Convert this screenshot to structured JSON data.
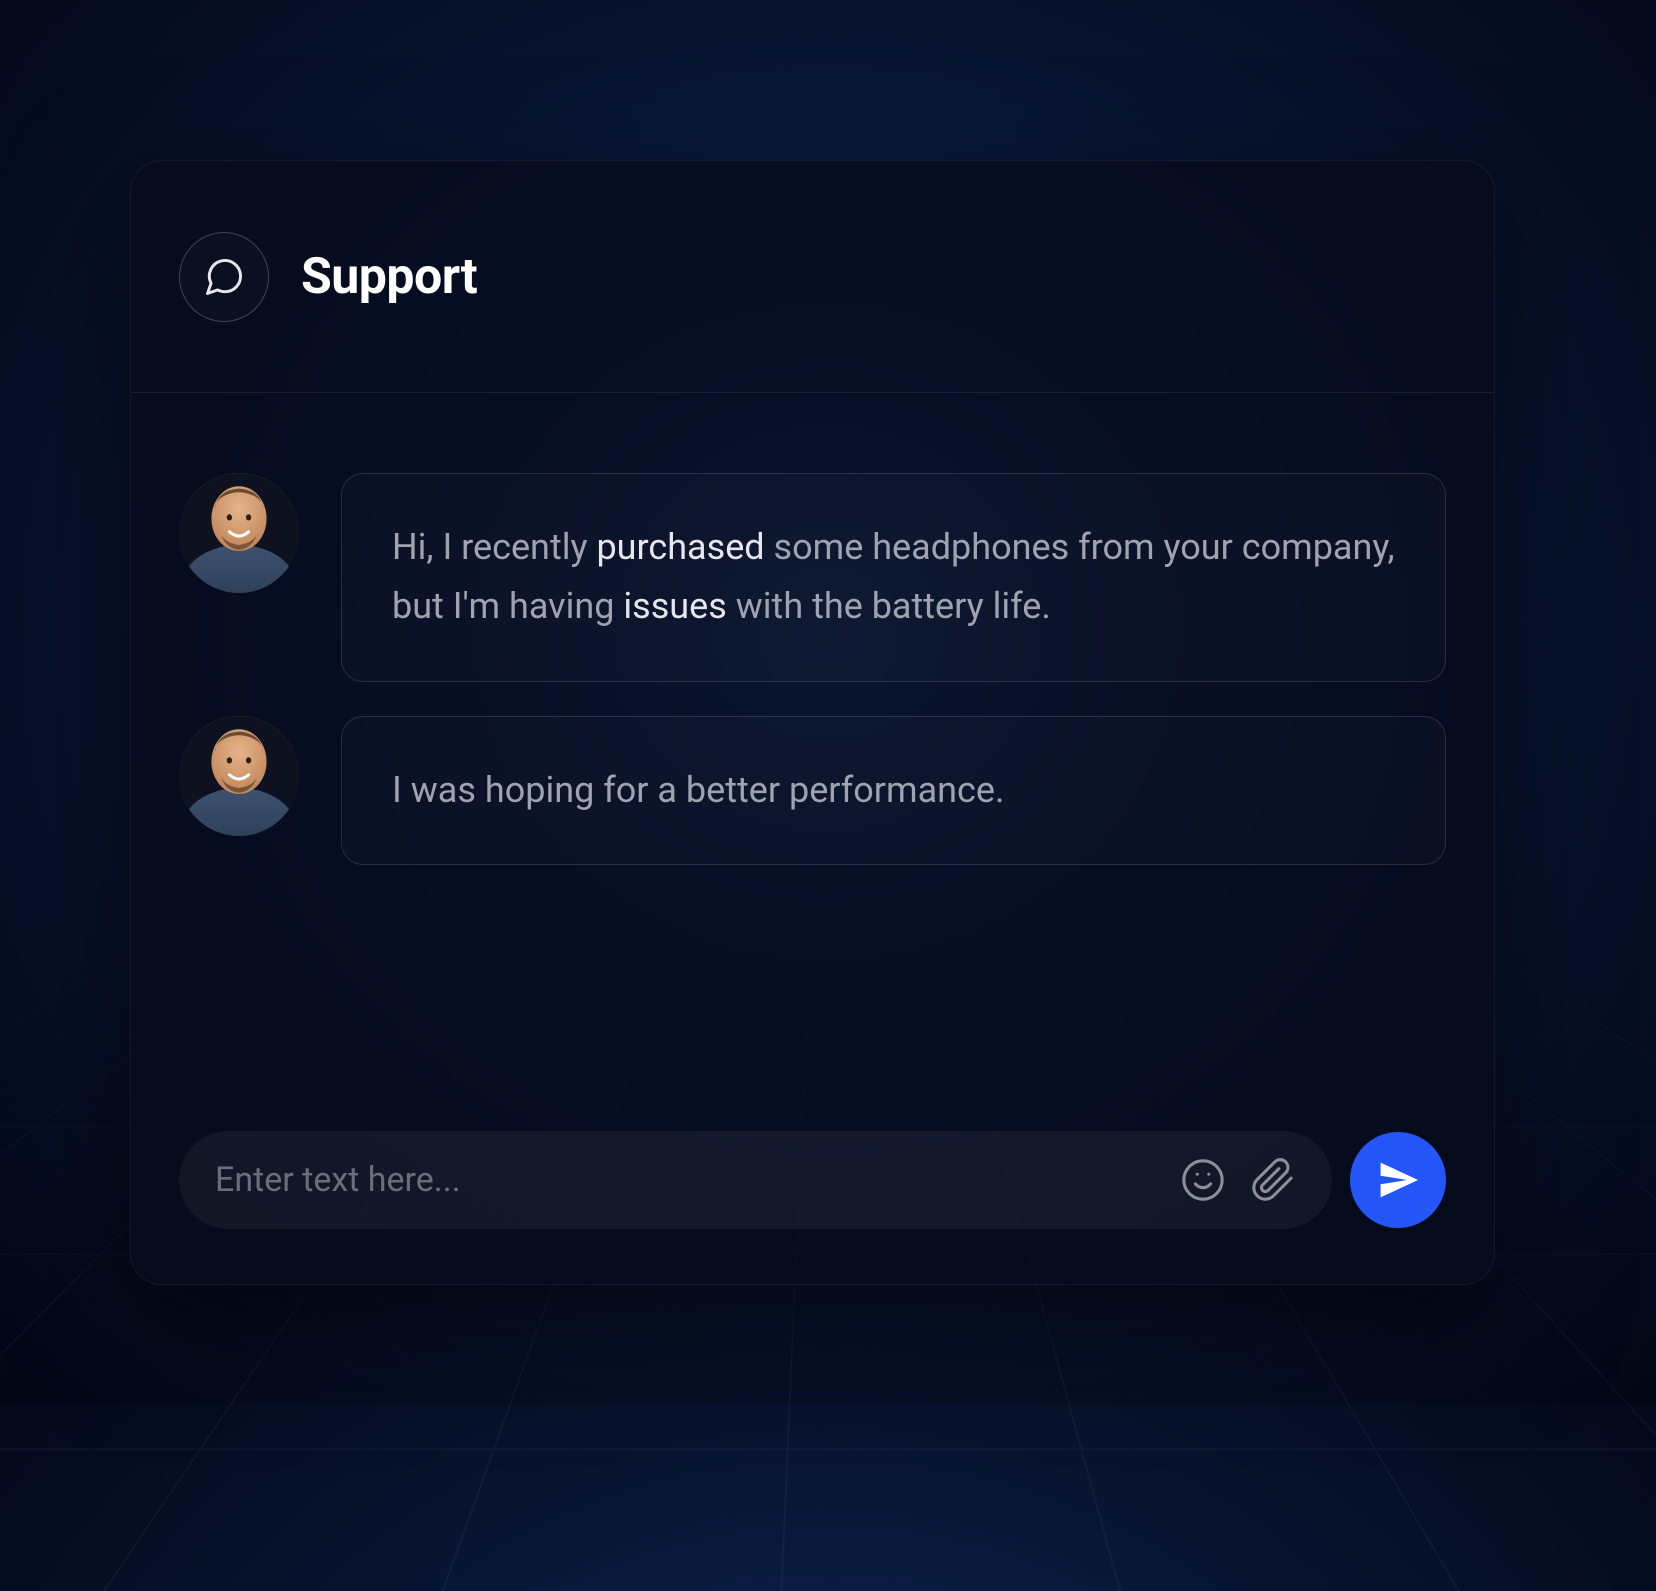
{
  "header": {
    "title": "Support",
    "icon_name": "chat-bubble-icon"
  },
  "messages": [
    {
      "author": "user",
      "avatar": "user-avatar",
      "segments": [
        {
          "text": "Hi, I recently ",
          "hl": false
        },
        {
          "text": "purchased",
          "hl": true
        },
        {
          "text": " some headphones from your company, but I'm having ",
          "hl": false
        },
        {
          "text": "issues",
          "hl": true
        },
        {
          "text": " with the battery life.",
          "hl": false
        }
      ]
    },
    {
      "author": "user",
      "avatar": "user-avatar",
      "segments": [
        {
          "text": "I was hoping for a better performance.",
          "hl": false
        }
      ]
    }
  ],
  "input": {
    "placeholder": "Enter text here...",
    "value": "",
    "emoji_icon": "smile-icon",
    "attach_icon": "paperclip-icon",
    "send_icon": "send-icon"
  },
  "colors": {
    "accent": "#2455f6",
    "bg_dark": "#060a19",
    "text_muted": "#9ea3b0",
    "text_bright": "#e6e7ec"
  }
}
